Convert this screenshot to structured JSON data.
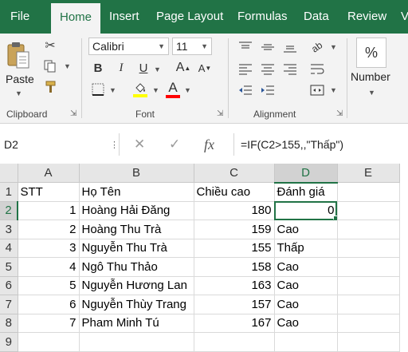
{
  "ribbon_tabs": {
    "file": "File",
    "home": "Home",
    "insert": "Insert",
    "page_layout": "Page Layout",
    "formulas": "Formulas",
    "data": "Data",
    "review": "Review",
    "view": "V"
  },
  "clipboard": {
    "paste_label": "Paste",
    "group_label": "Clipboard"
  },
  "font": {
    "font_name": "Calibri",
    "font_size": "11",
    "bold": "B",
    "italic": "I",
    "underline": "U",
    "grow": "A",
    "shrink": "A",
    "font_color_letter": "A",
    "group_label": "Font",
    "fill_color": "#ffff00",
    "font_color": "#ff0000"
  },
  "alignment": {
    "group_label": "Alignment"
  },
  "number": {
    "format_symbol": "%",
    "label": "Number"
  },
  "formula_bar": {
    "name_box": "D2",
    "formula": "=IF(C2>155,,\"Thấp\")"
  },
  "sheet": {
    "columns": [
      "A",
      "B",
      "C",
      "D",
      "E"
    ],
    "selected_column": "D",
    "selected_row": "2",
    "rows": [
      {
        "n": "1",
        "a": "STT",
        "b": "Họ Tên",
        "c": "Chiều cao",
        "d": "Đánh giá"
      },
      {
        "n": "2",
        "a": "1",
        "b": "Hoàng Hải Đăng",
        "c": "180",
        "d": "0"
      },
      {
        "n": "3",
        "a": "2",
        "b": "Hoàng Thu Trà",
        "c": "159",
        "d": "Cao"
      },
      {
        "n": "4",
        "a": "3",
        "b": "Nguyễn Thu Trà",
        "c": "155",
        "d": "Thấp"
      },
      {
        "n": "5",
        "a": "4",
        "b": "Ngô Thu Thảo",
        "c": "158",
        "d": "Cao"
      },
      {
        "n": "6",
        "a": "5",
        "b": "Nguyễn Hương Lan",
        "c": "163",
        "d": "Cao"
      },
      {
        "n": "7",
        "a": "6",
        "b": "Nguyễn Thùy Trang",
        "c": "157",
        "d": "Cao"
      },
      {
        "n": "8",
        "a": "7",
        "b": "Pham Minh Tú",
        "c": "167",
        "d": "Cao"
      },
      {
        "n": "9",
        "a": "",
        "b": "",
        "c": "",
        "d": ""
      }
    ]
  },
  "colors": {
    "excel_green": "#217346",
    "selection_header": "#d2d2d2"
  }
}
